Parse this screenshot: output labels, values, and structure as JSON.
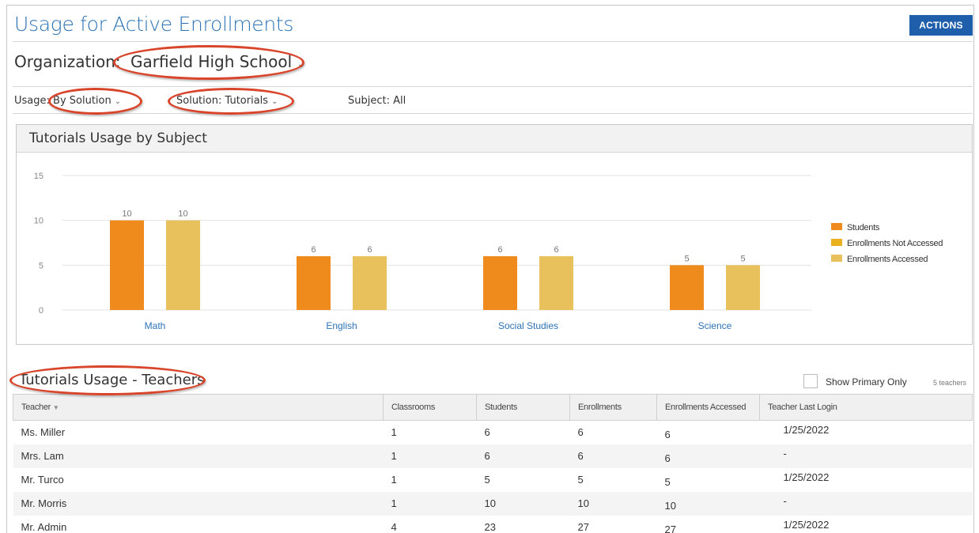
{
  "header": {
    "title": "Usage for Active Enrollments",
    "actions_label": "ACTIONS"
  },
  "organization": {
    "label": "Organization:",
    "value": "Garfield High School"
  },
  "filters": {
    "usage_label": "Usage:",
    "usage_value": "By Solution",
    "solution_label": "Solution:",
    "solution_value": "Tutorials",
    "subject_label": "Subject:",
    "subject_value": "All"
  },
  "chart_panel": {
    "title": "Tutorials Usage by Subject"
  },
  "chart_data": {
    "type": "bar",
    "title": "Tutorials Usage by Subject",
    "xlabel": "",
    "ylabel": "",
    "ylim": [
      0,
      15
    ],
    "yticks": [
      0,
      5,
      10,
      15
    ],
    "grid": true,
    "legend_position": "right",
    "categories": [
      "Math",
      "English",
      "Social Studies",
      "Science"
    ],
    "series": [
      {
        "name": "Students",
        "color": "#ef8a1c",
        "values": [
          10,
          6,
          6,
          5
        ]
      },
      {
        "name": "Enrollments Not Accessed",
        "color": "#eab11e",
        "values": [
          0,
          0,
          0,
          0
        ]
      },
      {
        "name": "Enrollments Accessed",
        "color": "#e8c05c",
        "values": [
          10,
          6,
          6,
          5
        ]
      }
    ]
  },
  "teachers_section": {
    "title": "Tutorials Usage - Teachers",
    "show_primary_label": "Show Primary Only",
    "count_label": "5 teachers"
  },
  "table": {
    "columns": [
      "Teacher",
      "Classrooms",
      "Students",
      "Enrollments",
      "Enrollments Accessed",
      "Teacher Last Login"
    ],
    "rows": [
      [
        "Ms. Miller",
        "1",
        "6",
        "6",
        "6",
        "1/25/2022"
      ],
      [
        "Mrs. Lam",
        "1",
        "6",
        "6",
        "6",
        "-"
      ],
      [
        "Mr. Turco",
        "1",
        "5",
        "5",
        "5",
        "1/25/2022"
      ],
      [
        "Mr. Morris",
        "1",
        "10",
        "10",
        "10",
        "-"
      ],
      [
        "Mr. Admin",
        "4",
        "23",
        "27",
        "27",
        "1/25/2022"
      ]
    ]
  },
  "icons": {
    "dropdown": "chevron-down-icon",
    "sort": "sort-down-icon"
  },
  "colors": {
    "accent": "#2d73b6",
    "button": "#1f5eab",
    "annotation": "#d9452b"
  }
}
